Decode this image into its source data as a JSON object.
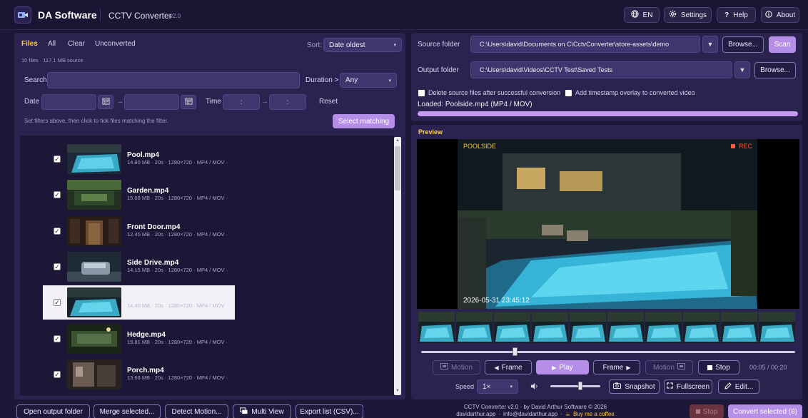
{
  "header": {
    "brand": "DA Software",
    "app_title": "CCTV Converter",
    "app_version": "v2.0",
    "buttons": {
      "lang": "EN",
      "settings": "Settings",
      "help": "Help",
      "about": "About"
    }
  },
  "files": {
    "tabs": [
      "Files",
      "All",
      "Clear",
      "Unconverted"
    ],
    "active_tab": "Files",
    "sort_label": "Sort:",
    "sort_value": "Date oldest",
    "summary": "10 files · 117.1 MB source",
    "search_label": "Search",
    "search_value": "",
    "duration_label": "Duration >",
    "duration_value": "Any",
    "date_label": "Date",
    "date_arrow": "→",
    "time_label": "Time",
    "time_colon": ":",
    "reset": "Reset",
    "hint": "Set filters above, then click to tick files matching the filter.",
    "select_matching": "Select matching",
    "items": [
      {
        "name": "Pool.mp4",
        "meta": "14.80 MB · 20s · 1280×720 · MP4 / MOV ·",
        "checked": "✓",
        "thumb": "pool"
      },
      {
        "name": "Garden.mp4",
        "meta": "15.68 MB · 20s · 1280×720 · MP4 / MOV ·",
        "checked": "✓",
        "thumb": "garden"
      },
      {
        "name": "Front Door.mp4",
        "meta": "12.45 MB · 20s · 1280×720 · MP4 / MOV ·",
        "checked": "✓",
        "thumb": "door"
      },
      {
        "name": "Side Drive.mp4",
        "meta": "14.15 MB · 20s · 1280×720 · MP4 / MOV ·",
        "checked": "✓",
        "thumb": "drive"
      },
      {
        "name": "",
        "meta": "14.40 MB · 20s · 1280×720 · MP4 / MOV",
        "checked": "✓",
        "thumb": "pool2"
      },
      {
        "name": "Hedge.mp4",
        "meta": "15.81 MB · 20s · 1280×720 · MP4 / MOV ·",
        "checked": "✓",
        "thumb": "hedge"
      },
      {
        "name": "Porch.mp4",
        "meta": "13.66 MB · 20s · 1280×720 · MP4 / MOV ·",
        "checked": "✓",
        "thumb": "porch"
      }
    ]
  },
  "source": {
    "label": "Source folder",
    "path": "C:\\Users\\david\\Documents on C\\CctvConverter\\store-assets\\demo",
    "browse": "Browse...",
    "scan": "Scan"
  },
  "output": {
    "label": "Output folder",
    "path": "C:\\Users\\david\\Videos\\CCTV Test\\Saved Tests",
    "browse": "Browse..."
  },
  "options": {
    "delete_source": "Delete source files after successful conversion",
    "timestamp_overlay": "Add timestamp overlay to converted video",
    "loaded": "Loaded: Poolside.mp4  (MP4 / MOV)",
    "progress": 1.0
  },
  "preview": {
    "title": "Preview",
    "camera_label": "POOLSIDE",
    "rec": "REC",
    "timestamp": "2026-05-31 23:45:12",
    "seek_fraction": 0.25,
    "controls": {
      "motion_prev": "Motion",
      "frame_prev": "Frame",
      "play": "Play",
      "frame_next": "Frame",
      "motion_next": "Motion",
      "stop": "Stop",
      "time": "00:05 / 00:20"
    },
    "speed_label": "Speed",
    "speed_value": "1×",
    "volume_fraction": 0.6,
    "snapshot": "Snapshot",
    "fullscreen": "Fullscreen",
    "edit": "Edit..."
  },
  "footer": {
    "open_output": "Open output folder",
    "merge": "Merge selected...",
    "detect_motion": "Detect Motion...",
    "multi_view": "Multi View",
    "export_list": "Export list (CSV)...",
    "credit_line1": "CCTV Converter v2.0  ·  by David Arthur Software © 2026",
    "credit_site": "davidarthur.app",
    "credit_email": "info@davidarthur.app",
    "credit_coffee": "Buy me a coffee",
    "credit_sep": "·",
    "stop": "Stop",
    "convert": "Convert selected (8)"
  },
  "colors": {
    "accent": "#b58ee8",
    "background": "#1e1838",
    "panel": "#2a2350",
    "rec": "#ff5a3c",
    "camera_label": "#ffcc33"
  }
}
